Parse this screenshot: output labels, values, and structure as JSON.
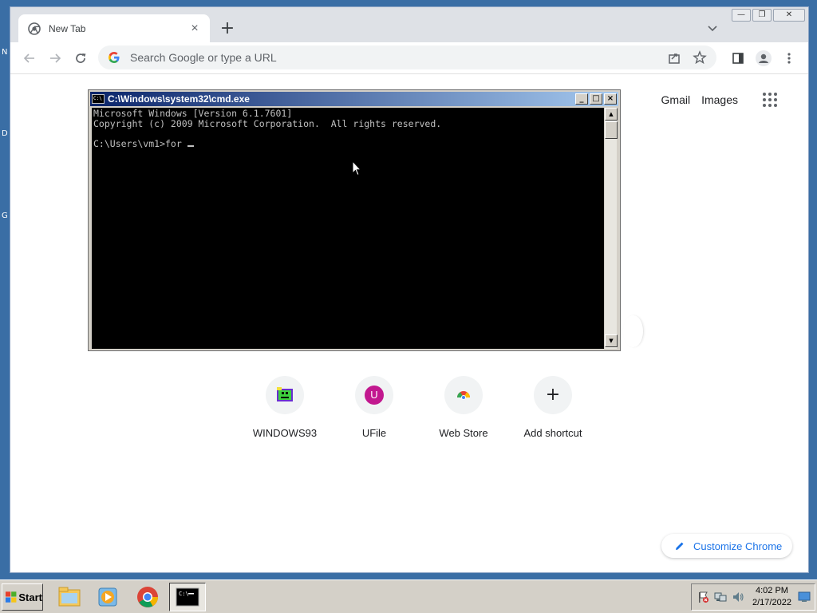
{
  "desktop": {
    "fragments": [
      "N",
      "D",
      "G"
    ]
  },
  "browser": {
    "tab": {
      "title": "New Tab",
      "close": "×"
    },
    "new_tab_symbol": "+",
    "window_controls": {
      "minimize": "—",
      "restore": "❐",
      "close": "✕"
    },
    "omnibox": {
      "placeholder": "Search Google or type a URL"
    },
    "ntp": {
      "gmail": "Gmail",
      "images": "Images",
      "shortcuts": [
        {
          "label": "WINDOWS93",
          "icon": "windows93-icon"
        },
        {
          "label": "UFile",
          "icon": "ufile-icon",
          "letter": "U"
        },
        {
          "label": "Web Store",
          "icon": "chrome-webstore-icon"
        },
        {
          "label": "Add shortcut",
          "icon": "plus-icon",
          "symbol": "+"
        }
      ],
      "customize_label": "Customize Chrome"
    }
  },
  "cmd": {
    "title": "C:\\Windows\\system32\\cmd.exe",
    "icon_text": "C:\\",
    "buttons": {
      "minimize": "_",
      "maximize": "□",
      "close": "×"
    },
    "lines": [
      "Microsoft Windows [Version 6.1.7601]",
      "Copyright (c) 2009 Microsoft Corporation.  All rights reserved.",
      "",
      "C:\\Users\\vm1>for "
    ],
    "scroll_up": "▲",
    "scroll_down": "▼"
  },
  "taskbar": {
    "start_label": "Start",
    "apps": [
      "file-explorer-icon",
      "media-player-icon",
      "chrome-icon",
      "cmd-icon"
    ],
    "clock_time": "4:02 PM",
    "clock_date": "2/17/2022"
  },
  "colors": {
    "desktop": "#3a6ea5",
    "cmd_title_start": "#0a246a",
    "cmd_title_end": "#a6caf0",
    "accent": "#1a73e8"
  }
}
